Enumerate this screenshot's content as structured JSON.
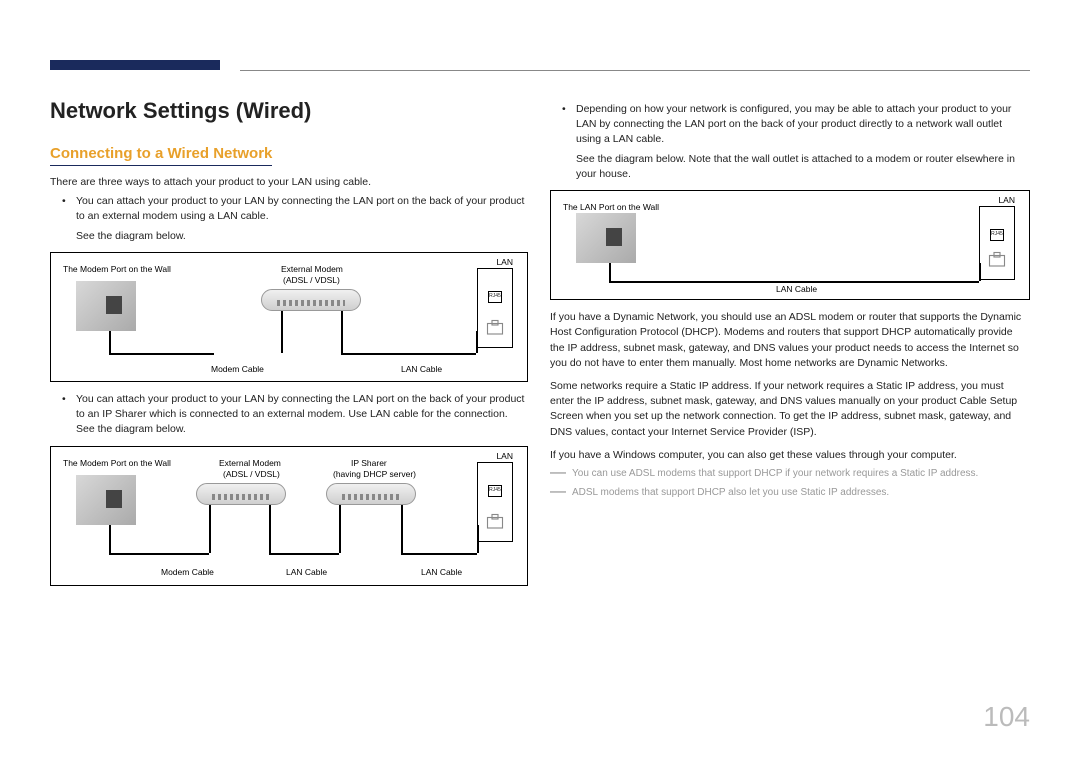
{
  "page_title": "Network Settings (Wired)",
  "section_title": "Connecting to a Wired Network",
  "page_number": "104",
  "left": {
    "intro": "There are three ways to attach your product to your LAN using cable.",
    "bullet1": "You can attach your product to your LAN by connecting the LAN port on the back of your product to an external modem using a LAN cable.",
    "see1": "See the diagram below.",
    "diag1": {
      "wall": "The Modem Port on the Wall",
      "modem": "External Modem",
      "modemsub": "(ADSL / VDSL)",
      "lan": "LAN",
      "rj45": "RJ45",
      "modemcable": "Modem Cable",
      "lancable": "LAN Cable"
    },
    "bullet2": "You can attach your product to your LAN by connecting the LAN port on the back of your product to an IP Sharer which is connected to an external modem. Use LAN cable for the connection. See the diagram below.",
    "diag2": {
      "wall": "The Modem Port on the Wall",
      "modem": "External Modem",
      "modemsub": "(ADSL / VDSL)",
      "sharer": "IP Sharer",
      "sharersub": "(having DHCP server)",
      "lan": "LAN",
      "rj45": "RJ45",
      "modemcable": "Modem Cable",
      "lancable1": "LAN Cable",
      "lancable2": "LAN Cable"
    }
  },
  "right": {
    "bullet3": "Depending on how your network is configured, you may be able to attach your product to your LAN by connecting the LAN port on the back of your product directly to a network wall outlet using a LAN cable.",
    "note3": "See the diagram below. Note that the wall outlet is attached to a modem or router elsewhere in your house.",
    "diag3": {
      "wall": "The LAN Port on the Wall",
      "lan": "LAN",
      "rj45": "RJ45",
      "lancable": "LAN Cable"
    },
    "p1": "If you have a Dynamic Network, you should use an ADSL modem or router that supports the Dynamic Host Configuration Protocol (DHCP). Modems and routers that support DHCP automatically provide the IP address, subnet mask, gateway, and DNS values your product needs to access the Internet so you do not have to enter them manually. Most home networks are Dynamic Networks.",
    "p2": "Some networks require a Static IP address. If your network requires a Static IP address, you must enter the IP address, subnet mask, gateway, and DNS values manually on your product Cable Setup Screen when you set up the network connection. To get the IP address, subnet mask, gateway, and DNS values, contact your Internet Service Provider (ISP).",
    "p3": "If you have a Windows computer, you can also get these values through your computer.",
    "f1": "You can use ADSL modems that support DHCP if your network requires a Static IP address.",
    "f2": "ADSL modems that support DHCP also let you use Static IP addresses."
  }
}
